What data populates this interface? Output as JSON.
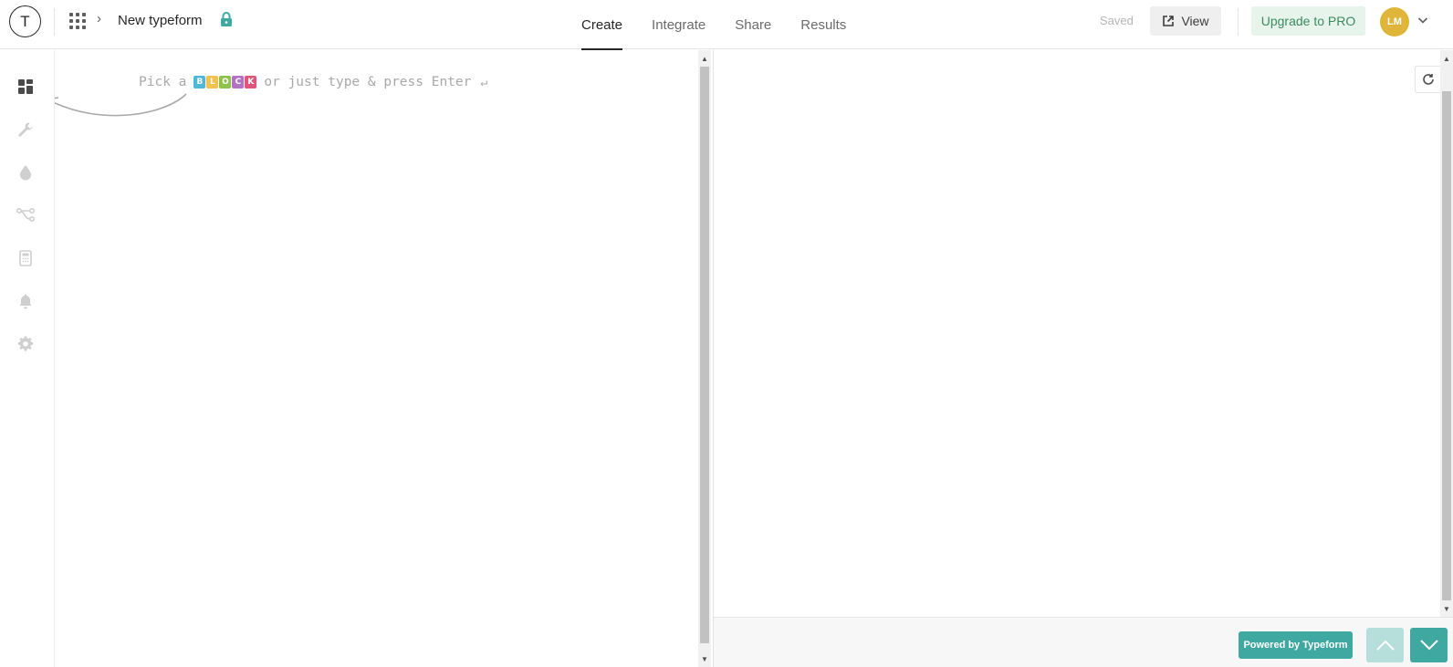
{
  "header": {
    "logo_letter": "T",
    "form_title": "New typeform",
    "tabs": [
      {
        "label": "Create"
      },
      {
        "label": "Integrate"
      },
      {
        "label": "Share"
      },
      {
        "label": "Results"
      }
    ],
    "active_tab": "Create",
    "saved_status": "Saved",
    "view_label": "View",
    "upgrade_label": "Upgrade to PRO",
    "avatar_initials": "LM"
  },
  "sidebar": {
    "items": [
      {
        "icon": "blocks-icon"
      },
      {
        "icon": "wrench-icon"
      },
      {
        "icon": "drop-icon"
      },
      {
        "icon": "logic-jump-icon"
      },
      {
        "icon": "calculator-icon"
      },
      {
        "icon": "bell-icon"
      },
      {
        "icon": "gear-icon"
      }
    ]
  },
  "builder": {
    "hint_prefix": "Pick a",
    "block_letters": [
      "B",
      "L",
      "O",
      "C",
      "K"
    ],
    "block_colors": [
      "#4fb8d6",
      "#f2c14e",
      "#8cc34b",
      "#b472c5",
      "#e0557a"
    ],
    "hint_suffix": "or just type & press Enter",
    "enter_glyph": "↵"
  },
  "preview": {
    "powered_label": "Powered by Typeform"
  },
  "colors": {
    "accent": "#3fa8a1",
    "upgrade_bg": "#e7f4ec",
    "upgrade_text": "#3d8a5f",
    "avatar_bg": "#e0b63a"
  }
}
